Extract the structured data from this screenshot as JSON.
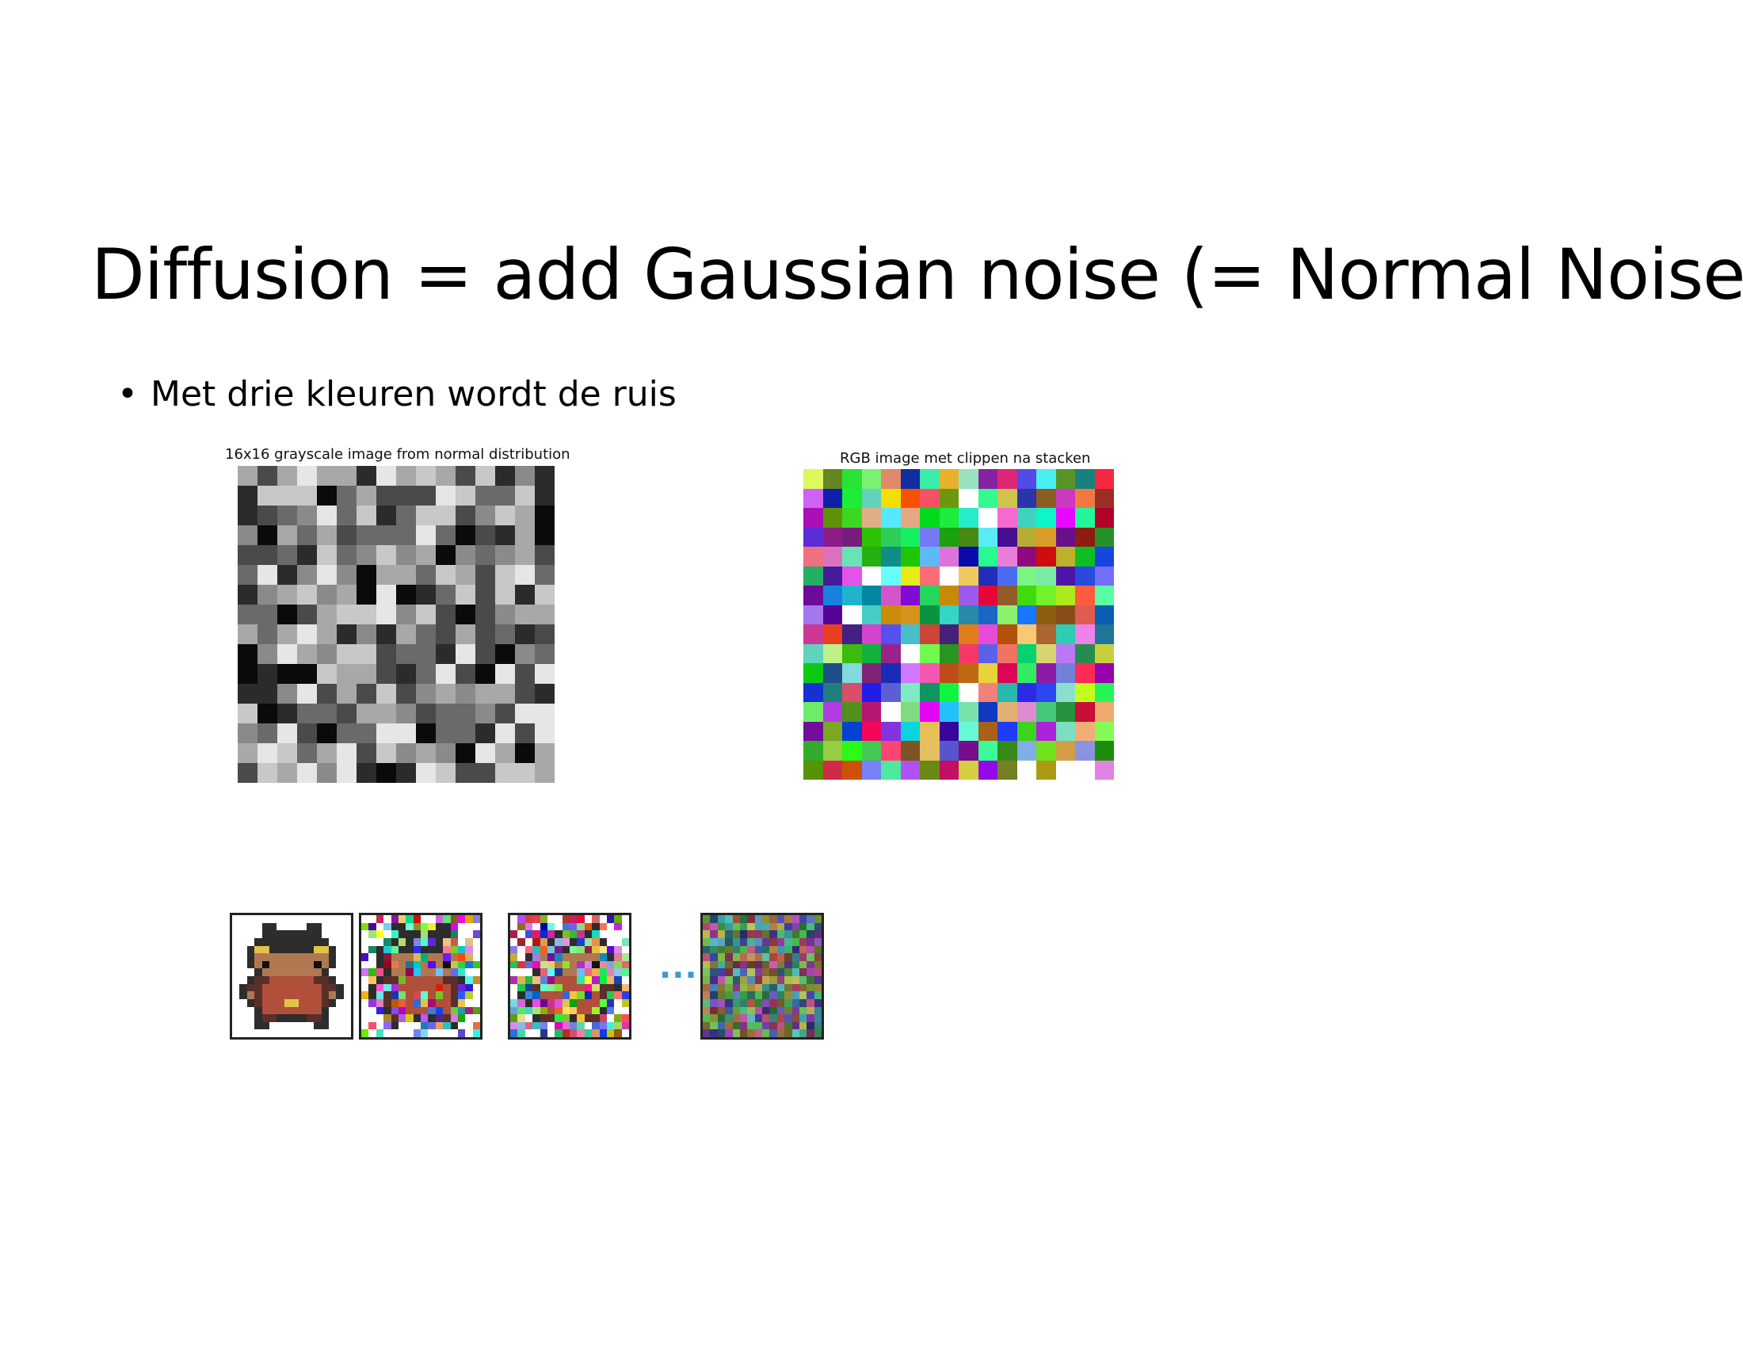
{
  "slide": {
    "title": "Diffusion = add Gaussian noise (= Normal Noise)",
    "bullets": [
      {
        "symbol": "•",
        "text": "Met drie kleuren wordt de ruis"
      }
    ]
  },
  "figures": {
    "grayscale_title": "16x16 grayscale image from normal distribution",
    "rgb_title": "RGB image met clippen na stacken",
    "sequence_ellipsis": "..."
  }
}
